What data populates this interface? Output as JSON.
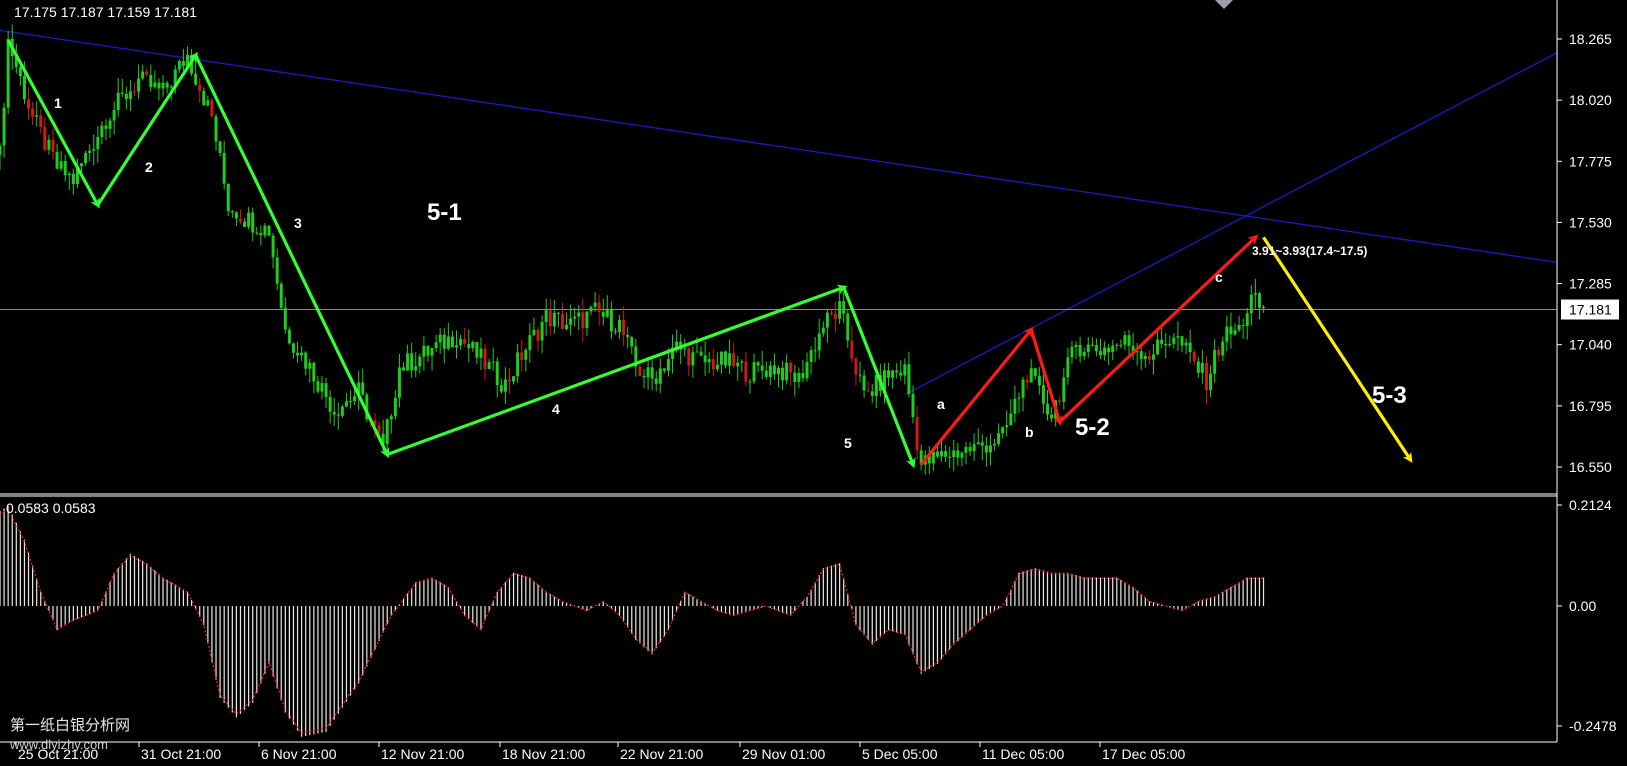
{
  "ohlc_readout": "17.175 17.187 17.159 17.181",
  "oscillator_readout": "0.0583 0.0583",
  "watermark": {
    "line1": "第一纸白银分析网",
    "line2": "www.dlyizhy.com"
  },
  "colors": {
    "background": "#000000",
    "axis": "#ffffff",
    "wave_green": "#33ff33",
    "wave_red": "#ff1a1a",
    "wave_yellow": "#ffee00",
    "trendline_blue": "#1a1ab8",
    "candle": "#1fcc1f",
    "candle_down": "#cc1a1a",
    "price_line": "#8a8a8a",
    "histogram": "#e8e8e8",
    "signal": "#ff2020"
  },
  "annotations": {
    "w1": "1",
    "w2": "2",
    "w3": "3",
    "w4": "4",
    "w5": "5",
    "wa": "a",
    "wb": "b",
    "wc": "c",
    "label_5_1": "5-1",
    "label_5_2": "5-2",
    "label_5_3": "5-3",
    "target": "3.91~3.93(17.4~17.5)"
  },
  "chart_data": [
    {
      "type": "candlestick",
      "y_ticks": [
        "18.265",
        "18.020",
        "17.775",
        "17.530",
        "17.285",
        "17.040",
        "16.795",
        "16.550"
      ],
      "ylim": [
        16.48,
        18.43
      ],
      "current_price": 17.181,
      "current_price_label": "17.181",
      "x_labels": [
        "25 Oct 21:00",
        "31 Oct 21:00",
        "6 Nov 21:00",
        "12 Nov 21:00",
        "18 Nov 21:00",
        "22 Nov 21:00",
        "29 Nov 01:00",
        "5 Dec 05:00",
        "11 Dec 05:00",
        "17 Dec 05:00"
      ],
      "close_path": [
        [
          0,
          17.8
        ],
        [
          2,
          18.26
        ],
        [
          8,
          17.95
        ],
        [
          14,
          17.75
        ],
        [
          18,
          17.7
        ],
        [
          26,
          17.95
        ],
        [
          34,
          18.1
        ],
        [
          40,
          18.05
        ],
        [
          46,
          18.2
        ],
        [
          52,
          17.95
        ],
        [
          56,
          17.6
        ],
        [
          60,
          17.55
        ],
        [
          66,
          17.5
        ],
        [
          70,
          17.1
        ],
        [
          76,
          16.95
        ],
        [
          82,
          16.78
        ],
        [
          88,
          16.85
        ],
        [
          94,
          16.62
        ],
        [
          98,
          16.95
        ],
        [
          104,
          17.0
        ],
        [
          112,
          17.08
        ],
        [
          118,
          16.98
        ],
        [
          124,
          16.88
        ],
        [
          128,
          17.0
        ],
        [
          134,
          17.15
        ],
        [
          140,
          17.12
        ],
        [
          146,
          17.17
        ],
        [
          152,
          17.12
        ],
        [
          156,
          16.95
        ],
        [
          160,
          16.9
        ],
        [
          166,
          17.03
        ],
        [
          172,
          16.97
        ],
        [
          178,
          16.97
        ],
        [
          184,
          16.93
        ],
        [
          190,
          16.95
        ],
        [
          196,
          16.9
        ],
        [
          202,
          17.12
        ],
        [
          206,
          17.18
        ],
        [
          212,
          16.83
        ],
        [
          218,
          16.92
        ],
        [
          222,
          16.94
        ],
        [
          226,
          16.56
        ],
        [
          232,
          16.6
        ],
        [
          240,
          16.63
        ],
        [
          246,
          16.67
        ],
        [
          252,
          16.93
        ],
        [
          258,
          16.76
        ],
        [
          264,
          17.04
        ],
        [
          270,
          17.02
        ],
        [
          276,
          17.05
        ],
        [
          282,
          17.0
        ],
        [
          288,
          17.08
        ],
        [
          296,
          16.9
        ],
        [
          300,
          17.07
        ],
        [
          304,
          17.1
        ],
        [
          307,
          17.22
        ],
        [
          310,
          17.18
        ]
      ],
      "waves": {
        "green": [
          [
            2,
            18.26
          ],
          [
            24,
            17.6
          ],
          [
            48,
            18.2
          ],
          [
            95,
            16.6
          ],
          [
            207,
            17.27
          ],
          [
            224,
            16.56
          ]
        ],
        "red": [
          [
            226,
            16.56
          ],
          [
            253,
            17.1
          ],
          [
            260,
            16.73
          ],
          [
            308,
            17.47
          ]
        ],
        "yellow": [
          [
            310,
            17.47
          ],
          [
            346,
            16.58
          ]
        ]
      },
      "trendlines": [
        {
          "from": [
            0,
            18.3
          ],
          "to": [
            382,
            17.37
          ]
        },
        {
          "from": [
            222,
            16.84
          ],
          "to": [
            382,
            18.21
          ]
        }
      ]
    },
    {
      "type": "histogram",
      "y_ticks": [
        "0.2124",
        "0.00",
        "-0.2478"
      ],
      "ylim": [
        -0.2478,
        0.2124
      ],
      "current_value": 0.0583,
      "shape": [
        [
          0,
          0.2
        ],
        [
          2,
          0.21
        ],
        [
          6,
          0.14
        ],
        [
          10,
          0.03
        ],
        [
          14,
          -0.05
        ],
        [
          18,
          -0.03
        ],
        [
          24,
          -0.01
        ],
        [
          28,
          0.07
        ],
        [
          32,
          0.11
        ],
        [
          36,
          0.09
        ],
        [
          40,
          0.06
        ],
        [
          46,
          0.03
        ],
        [
          50,
          -0.04
        ],
        [
          54,
          -0.19
        ],
        [
          58,
          -0.23
        ],
        [
          62,
          -0.2
        ],
        [
          66,
          -0.12
        ],
        [
          70,
          -0.22
        ],
        [
          74,
          -0.27
        ],
        [
          80,
          -0.26
        ],
        [
          84,
          -0.21
        ],
        [
          88,
          -0.16
        ],
        [
          92,
          -0.09
        ],
        [
          96,
          -0.02
        ],
        [
          102,
          0.05
        ],
        [
          106,
          0.06
        ],
        [
          110,
          0.04
        ],
        [
          114,
          -0.02
        ],
        [
          118,
          -0.05
        ],
        [
          122,
          0.03
        ],
        [
          126,
          0.07
        ],
        [
          130,
          0.06
        ],
        [
          134,
          0.03
        ],
        [
          138,
          0.01
        ],
        [
          144,
          -0.01
        ],
        [
          148,
          0.01
        ],
        [
          152,
          -0.02
        ],
        [
          156,
          -0.07
        ],
        [
          160,
          -0.1
        ],
        [
          164,
          -0.05
        ],
        [
          168,
          0.03
        ],
        [
          172,
          0.01
        ],
        [
          176,
          -0.01
        ],
        [
          180,
          -0.02
        ],
        [
          184,
          -0.01
        ],
        [
          188,
          0.0
        ],
        [
          194,
          -0.02
        ],
        [
          198,
          0.02
        ],
        [
          202,
          0.08
        ],
        [
          206,
          0.09
        ],
        [
          210,
          -0.04
        ],
        [
          214,
          -0.08
        ],
        [
          218,
          -0.05
        ],
        [
          222,
          -0.06
        ],
        [
          226,
          -0.14
        ],
        [
          230,
          -0.12
        ],
        [
          234,
          -0.08
        ],
        [
          238,
          -0.05
        ],
        [
          242,
          -0.02
        ],
        [
          246,
          0.0
        ],
        [
          250,
          0.07
        ],
        [
          254,
          0.08
        ],
        [
          258,
          0.07
        ],
        [
          262,
          0.07
        ],
        [
          266,
          0.06
        ],
        [
          270,
          0.06
        ],
        [
          274,
          0.06
        ],
        [
          278,
          0.04
        ],
        [
          282,
          0.01
        ],
        [
          286,
          0.0
        ],
        [
          290,
          -0.01
        ],
        [
          294,
          0.01
        ],
        [
          298,
          0.02
        ],
        [
          302,
          0.04
        ],
        [
          306,
          0.06
        ],
        [
          310,
          0.06
        ]
      ]
    }
  ]
}
